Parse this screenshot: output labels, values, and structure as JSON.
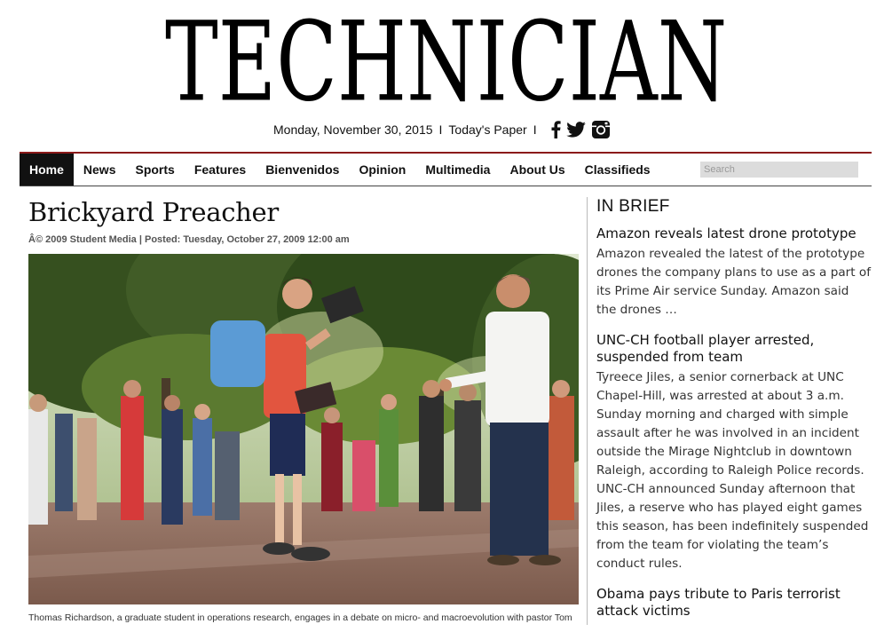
{
  "masthead": {
    "logo_text": "TECHNICIAN",
    "date": "Monday, November 30, 2015",
    "separator": "I",
    "todays_paper": "Today's Paper",
    "social_icons": [
      "facebook-icon",
      "twitter-icon",
      "instagram-icon"
    ]
  },
  "nav": {
    "items": [
      {
        "label": "Home",
        "active": true
      },
      {
        "label": "News"
      },
      {
        "label": "Sports"
      },
      {
        "label": "Features"
      },
      {
        "label": "Bienvenidos"
      },
      {
        "label": "Opinion"
      },
      {
        "label": "Multimedia"
      },
      {
        "label": "About Us"
      },
      {
        "label": "Classifieds"
      }
    ],
    "search_placeholder": "Search",
    "accent_color": "#8b1a1a"
  },
  "article": {
    "headline": "Brickyard Preacher",
    "byline": "Â© 2009 Student Media | Posted: Tuesday, October 27, 2009 12:00 am",
    "caption": "Thomas Richardson, a graduate student in operations research, engages in a debate on micro- and macroevolution with pastor Tom"
  },
  "sidebar": {
    "heading": "IN BRIEF",
    "items": [
      {
        "title": "Amazon reveals latest drone prototype",
        "body": "Amazon revealed the latest of the prototype drones the company plans to use as a part of its Prime Air service Sunday. Amazon said the drones …"
      },
      {
        "title": "UNC-CH football player arrested, suspended from team",
        "body": "Tyreece Jiles, a senior cornerback at UNC Chapel-Hill, was arrested at about 3 a.m. Sunday morning and charged with simple assault after he was involved in an incident outside the Mirage Nightclub in downtown Raleigh, according to Raleigh Police records. UNC-CH announced Sunday afternoon that Jiles, a reserve who has played eight games this season, has been indefinitely suspended from the team for violating the team’s conduct rules."
      },
      {
        "title": "Obama pays tribute to Paris terrorist attack victims",
        "body": ""
      }
    ]
  }
}
